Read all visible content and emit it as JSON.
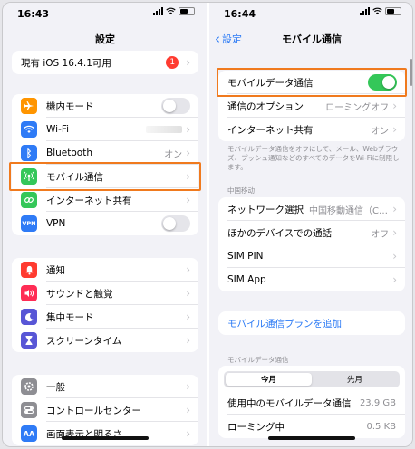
{
  "left": {
    "time": "16:43",
    "title": "設定",
    "update": {
      "label": "現有 iOS 16.4.1可用",
      "badge": "1"
    },
    "group1": [
      {
        "label": "機内モード",
        "icon": "airplane-icon",
        "color": "#ff9500",
        "toggle": false
      },
      {
        "label": "Wi-Fi",
        "icon": "wifi-icon",
        "color": "#2f7bf6",
        "value": ""
      },
      {
        "label": "Bluetooth",
        "icon": "bluetooth-icon",
        "color": "#2f7bf6",
        "value": "オン"
      },
      {
        "label": "モバイル通信",
        "icon": "antenna-icon",
        "color": "#34c759"
      },
      {
        "label": "インターネット共有",
        "icon": "link-icon",
        "color": "#34c759"
      },
      {
        "label": "VPN",
        "icon": "vpn-icon",
        "color": "#2f7bf6",
        "toggle": false
      }
    ],
    "group2": [
      {
        "label": "通知",
        "icon": "bell-icon",
        "color": "#ff3b30"
      },
      {
        "label": "サウンドと触覚",
        "icon": "speaker-icon",
        "color": "#ff2d55"
      },
      {
        "label": "集中モード",
        "icon": "moon-icon",
        "color": "#5856d6"
      },
      {
        "label": "スクリーンタイム",
        "icon": "hourglass-icon",
        "color": "#5856d6"
      }
    ],
    "group3": [
      {
        "label": "一般",
        "icon": "gear-icon",
        "color": "#8e8e93"
      },
      {
        "label": "コントロールセンター",
        "icon": "sliders-icon",
        "color": "#8e8e93"
      },
      {
        "label": "画面表示と明るさ",
        "icon": "aa-icon",
        "color": "#2f7bf6"
      }
    ]
  },
  "right": {
    "time": "16:44",
    "back": "設定",
    "title": "モバイル通信",
    "data_row": {
      "label": "モバイルデータ通信",
      "toggle": true
    },
    "options": [
      {
        "label": "通信のオプション",
        "value": "ローミングオフ"
      },
      {
        "label": "インターネット共有",
        "value": "オン"
      }
    ],
    "footnote": "モバイルデータ通信をオフにして、メール、Webブラウズ、プッシュ通知などのすべてのデータをWi-Fiに制限します。",
    "carrier_label": "中国移动",
    "carrier_rows": [
      {
        "label": "ネットワーク選択",
        "value": "中国移動通信（CHI..."
      },
      {
        "label": "ほかのデバイスでの通話",
        "value": "オフ"
      },
      {
        "label": "SIM PIN",
        "value": ""
      },
      {
        "label": "SIM App",
        "value": ""
      }
    ],
    "add_plan": "モバイル通信プランを追加",
    "usage_label": "モバイルデータ通信",
    "segments": [
      "今月",
      "先月"
    ],
    "usage_rows": [
      {
        "label": "使用中のモバイルデータ通信",
        "value": "23.9 GB"
      },
      {
        "label": "ローミング中",
        "value": "0.5 KB"
      }
    ]
  }
}
